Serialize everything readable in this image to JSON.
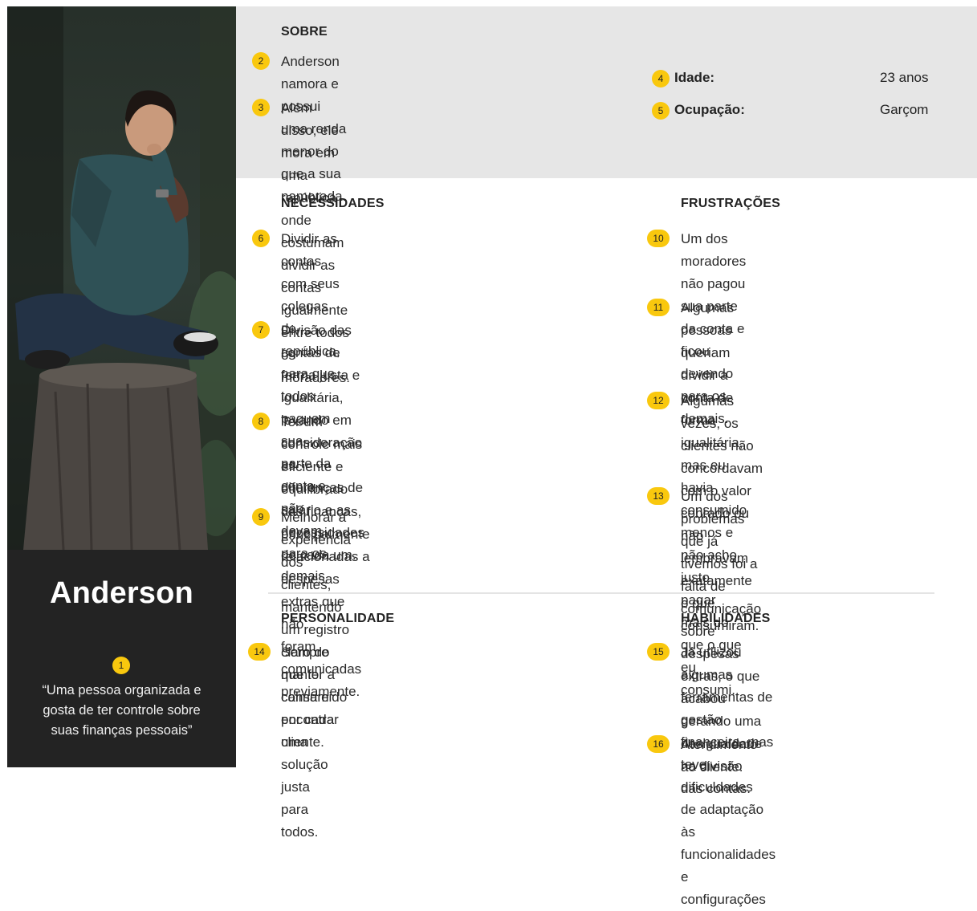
{
  "profile": {
    "name": "Anderson",
    "quote_badge": "1",
    "quote_lines": [
      "“Uma pessoa organizada e",
      "gosta de ter controle sobre",
      "suas finanças pessoais”"
    ]
  },
  "about": {
    "title": "SOBRE",
    "items": [
      {
        "num": "2",
        "lines": [
          "Anderson namora e possui uma renda",
          "menor do que a sua namorada."
        ]
      },
      {
        "num": "3",
        "lines": [
          "Além disso, ele mora em uma república",
          "onde costumam dividir as contas",
          "igualmente entre todos os moradores."
        ]
      }
    ],
    "facts": [
      {
        "num": "4",
        "label": "Idade:",
        "value": "23 anos"
      },
      {
        "num": "5",
        "label": "Ocupação:",
        "value": "Garçom"
      }
    ]
  },
  "needs": {
    "title": "NECESSIDADES",
    "items": [
      {
        "num": "6",
        "lines": [
          "Dividir as contas com seus colegas de",
          "república,  para que todos paguem sua",
          "parte da conta e não devam para os",
          "demais"
        ]
      },
      {
        "num": "7",
        "lines": [
          "Divisão das contas de forma justa e",
          "igualitária, levando em consideração as",
          "diferenças de salário e as necessidades",
          "de cada um."
        ]
      },
      {
        "num": "8",
        "lines": [
          "Ter um controle mais eficiente e",
          "equilibrado das finanças, principalmente",
          "relacionadas a despesas extras que não",
          "foram comunicadas previamente."
        ]
      },
      {
        "num": "9",
        "lines": [
          "Melhorar a experiência dos clientes,",
          "mantendo um registro claro do que foi",
          "consumido por cada cliente."
        ]
      }
    ]
  },
  "frustrations": {
    "title": "FRUSTRAÇÕES",
    "items": [
      {
        "num": "10",
        "lines": [
          "Um dos moradores não pagou sua parte",
          "da conta e ficou devendo para os",
          "demais."
        ]
      },
      {
        "num": "11",
        "lines": [
          "Algumas pessoas queriam dividir a",
          "conta de forma igualitária, mas eu havia",
          "consumido menos e não acho justo",
          "pagar mais do que o que eu consumi."
        ]
      },
      {
        "num": "12",
        "lines": [
          "Algumas vezes, os clientes não",
          "concordavam com o valor cobrado ou",
          "não lembravam exatamente o que",
          "consumiram."
        ]
      },
      {
        "num": "13",
        "lines": [
          "Um dos problemas que já tivemos foi a",
          "falta de comunicação sobre despesas",
          "extras, o que acabou gerando uma",
          "desigualdade na divisão das contas."
        ]
      }
    ]
  },
  "personality": {
    "title": "PERSONALIDADE",
    "items": [
      {
        "num": "14",
        "lines": [
          "Sempre manter a calma e encontrar uma",
          "solução justa para todos."
        ]
      }
    ]
  },
  "skills": {
    "title": "HABILIDADES",
    "items": [
      {
        "num": "15",
        "lines": [
          "Já utilizou algumas ferramentas de",
          "gestão financeira, mas teve dificuldades",
          "de adaptação às funcionalidades e",
          "configurações"
        ]
      },
      {
        "num": "16",
        "lines": [
          "Atendimento ao cliente."
        ]
      }
    ]
  },
  "colors": {
    "badge": "#f9c80e",
    "sidebar": "#232323",
    "about_bg": "#e6e6e6"
  },
  "icons": {
    "photo": "person-sitting-on-tree-stump-photo"
  }
}
